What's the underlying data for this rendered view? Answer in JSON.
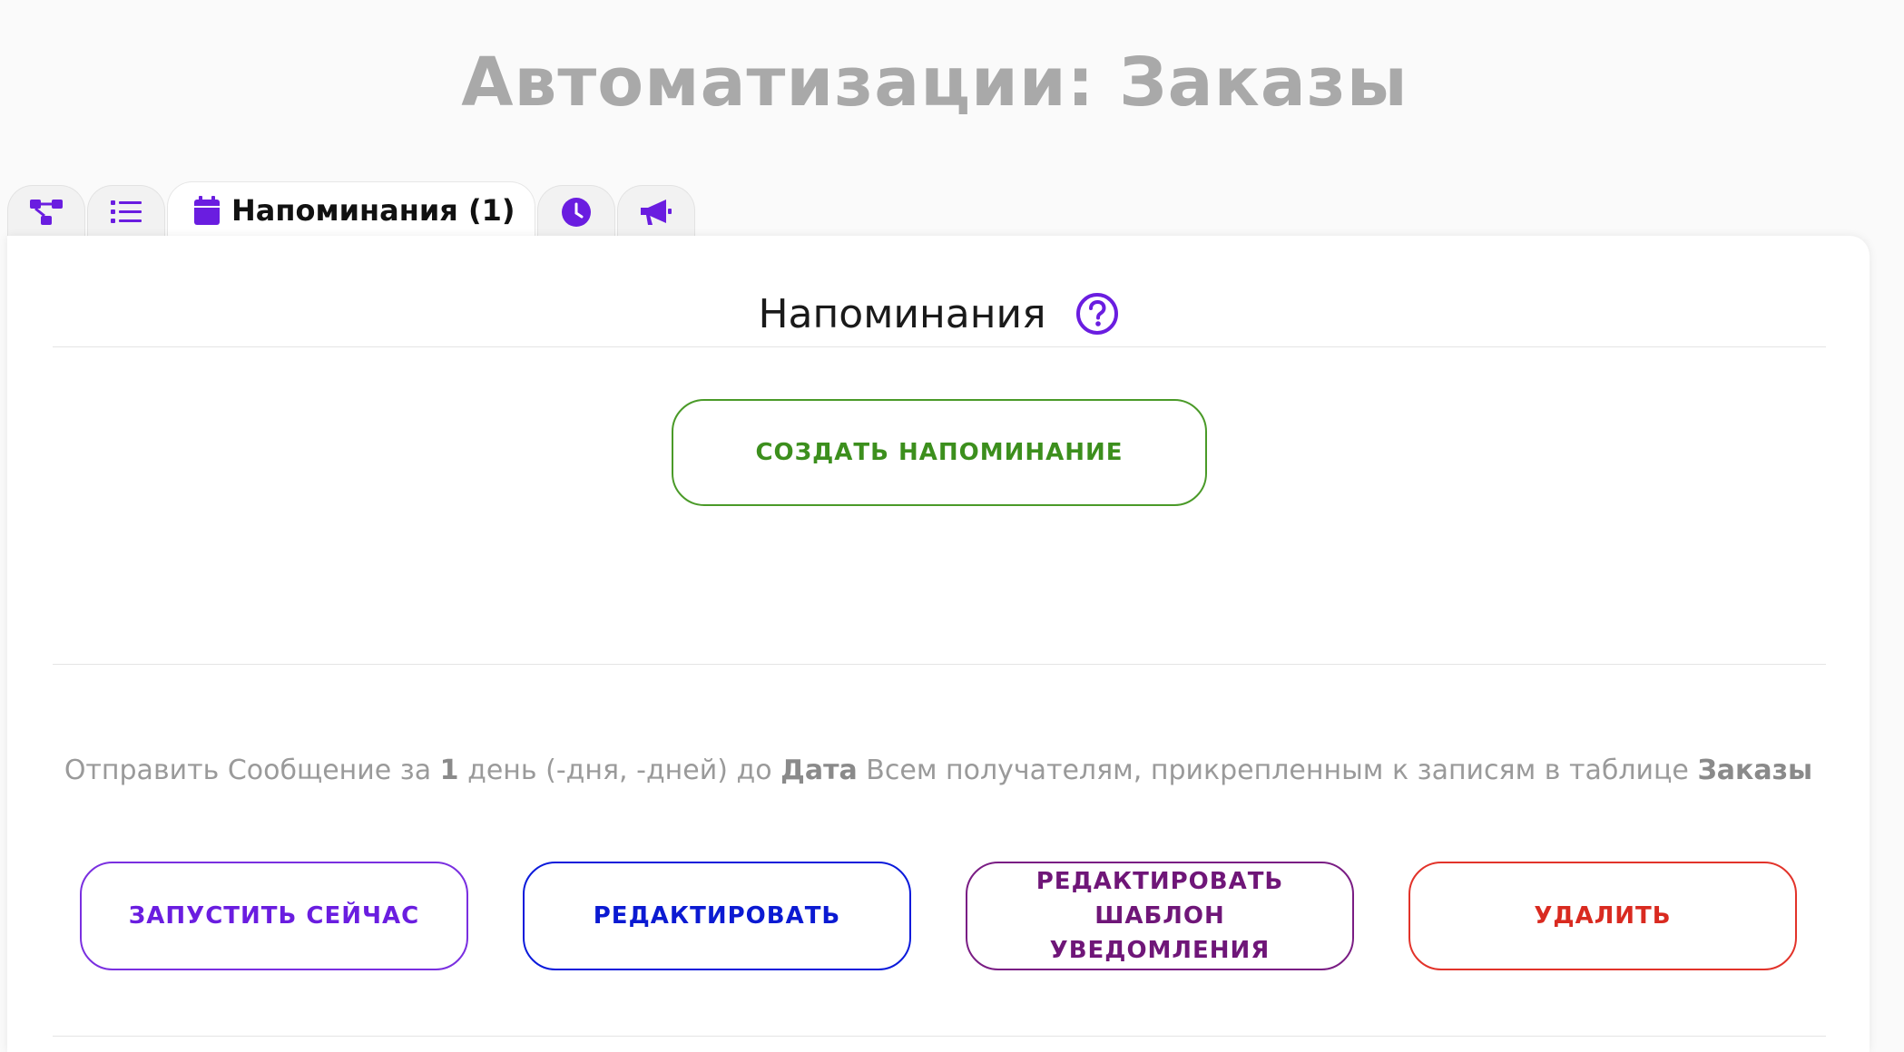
{
  "page": {
    "title": "Автоматизации: Заказы"
  },
  "tabs": [
    {
      "icon": "flowchart-icon",
      "label": ""
    },
    {
      "icon": "list-icon",
      "label": ""
    },
    {
      "icon": "calendar-icon",
      "label": "Напоминания (1)",
      "active": true
    },
    {
      "icon": "clock-icon",
      "label": ""
    },
    {
      "icon": "megaphone-icon",
      "label": ""
    }
  ],
  "section": {
    "title": "Напоминания",
    "help_icon": "question-circle-icon"
  },
  "create_button": {
    "label": "создать напоминание"
  },
  "reminder": {
    "description": {
      "prefix": "Отправить Сообщение за ",
      "count": "1",
      "unit": " день (-дня, -дней) до ",
      "field": "Дата",
      "middle": " Всем получателям, прикрепленным к записям в таблице ",
      "table": "Заказы"
    },
    "actions": {
      "run_now": "запустить сейчас",
      "edit": "редактировать",
      "edit_template": "редактировать шаблон уведомления",
      "delete": "удалить"
    }
  },
  "colors": {
    "accent": "#6a1de0",
    "create": "#3c8f1d",
    "run": "#6a1de0",
    "edit": "#0b1ad2",
    "template": "#6f1678",
    "delete": "#d92a20",
    "title": "#a9a9a9"
  }
}
